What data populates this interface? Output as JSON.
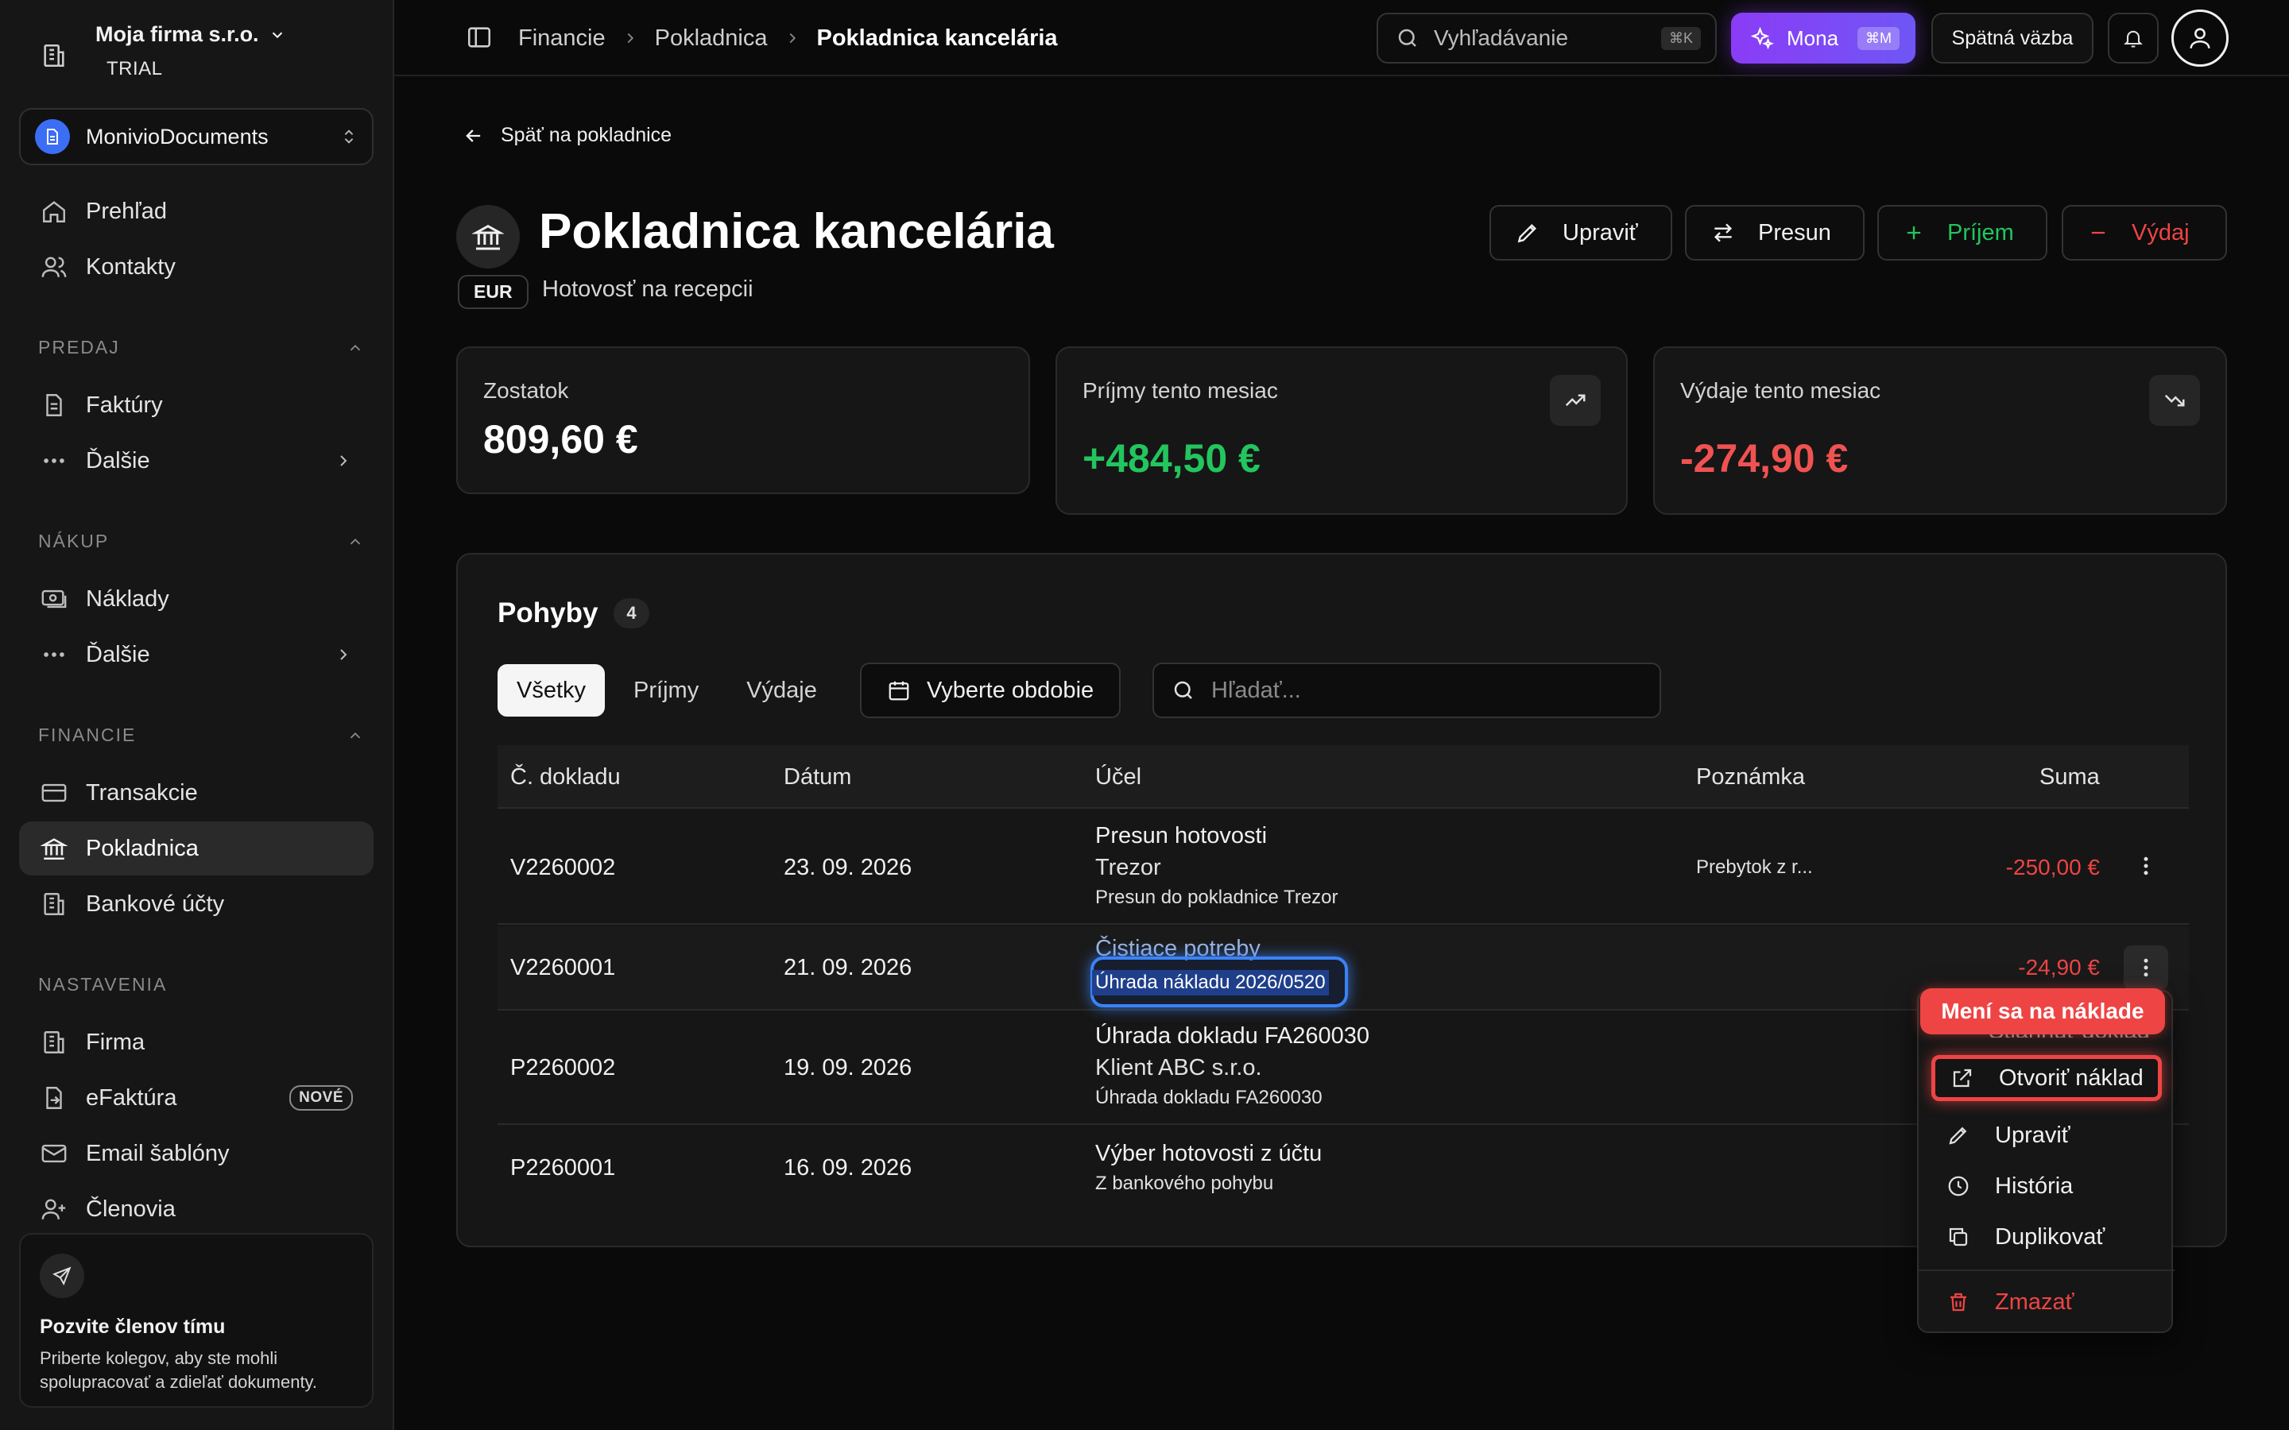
{
  "org": {
    "name": "Moja firma s.r.o.",
    "plan": "TRIAL"
  },
  "workspace": {
    "name": "MonivioDocuments"
  },
  "nav": {
    "overview": "Prehľad",
    "contacts": "Kontakty",
    "sales_header": "PREDAJ",
    "invoices": "Faktúry",
    "sales_more": "Ďalšie",
    "purchase_header": "NÁKUP",
    "costs": "Náklady",
    "purchase_more": "Ďalšie",
    "finance_header": "FINANCIE",
    "transactions": "Transakcie",
    "cashbox": "Pokladnica",
    "bank_accounts": "Bankové účty",
    "settings_header": "NASTAVENIA",
    "company": "Firma",
    "einvoice": "eFaktúra",
    "einvoice_badge": "NOVÉ",
    "email_templates": "Email šablóny",
    "members": "Členovia"
  },
  "invite": {
    "title": "Pozvite členov tímu",
    "text": "Priberte kolegov, aby ste mohli spolupracovať a zdieľať dokumenty."
  },
  "topbar": {
    "breadcrumb": [
      "Financie",
      "Pokladnica",
      "Pokladnica kancelária"
    ],
    "search_placeholder": "Vyhľadávanie",
    "search_kbd": "⌘K",
    "mona_label": "Mona",
    "mona_kbd": "⌘M",
    "feedback": "Spätná väzba"
  },
  "page": {
    "back_label": "Späť na pokladnice",
    "title": "Pokladnica kancelária",
    "currency": "EUR",
    "subtitle": "Hotovosť na recepcii",
    "actions": {
      "edit": "Upraviť",
      "transfer": "Presun",
      "income": "Príjem",
      "expense": "Výdaj"
    }
  },
  "cards": {
    "balance": {
      "label": "Zostatok",
      "value": "809,60 €"
    },
    "income": {
      "label": "Príjmy tento mesiac",
      "value": "+484,50 €",
      "icon": "trend-up-icon",
      "color": "#22c55e"
    },
    "expense": {
      "label": "Výdaje tento mesiac",
      "value": "-274,90 €",
      "icon": "trend-down-icon",
      "color": "#f05252"
    }
  },
  "movements": {
    "title": "Pohyby",
    "count": "4",
    "tabs": [
      "Všetky",
      "Príjmy",
      "Výdaje"
    ],
    "period_label": "Vyberte obdobie",
    "search_placeholder": "Hľadať...",
    "columns": {
      "doc": "Č. dokladu",
      "date": "Dátum",
      "purpose": "Účel",
      "note": "Poznámka",
      "amount": "Suma"
    },
    "rows": [
      {
        "doc": "V2260002",
        "date": "23. 09. 2026",
        "purpose": "Presun hotovosti",
        "purpose_sub": "Trezor",
        "purpose_small": "Presun do pokladnice Trezor",
        "note": "Prebytok z r...",
        "amount": "-250,00 €"
      },
      {
        "doc": "V2260001",
        "date": "21. 09. 2026",
        "purpose": "Čistiace potreby",
        "purpose_sub": "",
        "purpose_small": "Úhrada nákladu 2026/0520",
        "note": "",
        "amount": "-24,90 €"
      },
      {
        "doc": "P2260002",
        "date": "19. 09. 2026",
        "purpose": "Úhrada dokladu FA260030",
        "purpose_sub": "Klient ABC s.r.o.",
        "purpose_small": "Úhrada dokladu FA260030",
        "note": "",
        "amount": ""
      },
      {
        "doc": "P2260001",
        "date": "16. 09. 2026",
        "purpose": "Výber hotovosti z účtu",
        "purpose_sub": "",
        "purpose_small": "Z bankového pohybu",
        "note": "",
        "amount": ""
      }
    ]
  },
  "context_menu": {
    "tooltip": "Mení sa na náklade",
    "peek_item": "Stiahnuť doklad",
    "open_cost": "Otvoriť náklad",
    "edit": "Upraviť",
    "history": "História",
    "duplicate": "Duplikovať",
    "delete": "Zmazať"
  }
}
